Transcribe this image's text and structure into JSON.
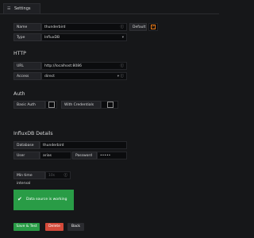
{
  "tab": {
    "icon": "sliders-icon",
    "label": "Settings"
  },
  "fields": {
    "name": {
      "label": "Name",
      "value": "thunderbird"
    },
    "default": {
      "label": "Default"
    },
    "type": {
      "label": "Type",
      "value": "InfluxDB"
    }
  },
  "http": {
    "title": "HTTP",
    "url_label": "URL",
    "url_value": "http://localhost:8086",
    "access_label": "Access",
    "access_value": "direct"
  },
  "auth": {
    "title": "Auth",
    "basic_label": "Basic Auth",
    "credentials_label": "With Credentials"
  },
  "influx": {
    "title": "InfluxDB Details",
    "database_label": "Database",
    "database_value": "thunderbird",
    "user_label": "User",
    "user_value": "arias",
    "password_label": "Password",
    "password_value": "•••••"
  },
  "interval": {
    "label": "Min time interval",
    "placeholder": "10s"
  },
  "status": {
    "message": "Data source is working",
    "color": "#299c46"
  },
  "buttons": {
    "save": "Save & Test",
    "delete": "Delete",
    "back": "Back"
  },
  "colors": {
    "accent": "#eb7b18",
    "primary": "#299c46",
    "danger": "#d44a3a"
  }
}
